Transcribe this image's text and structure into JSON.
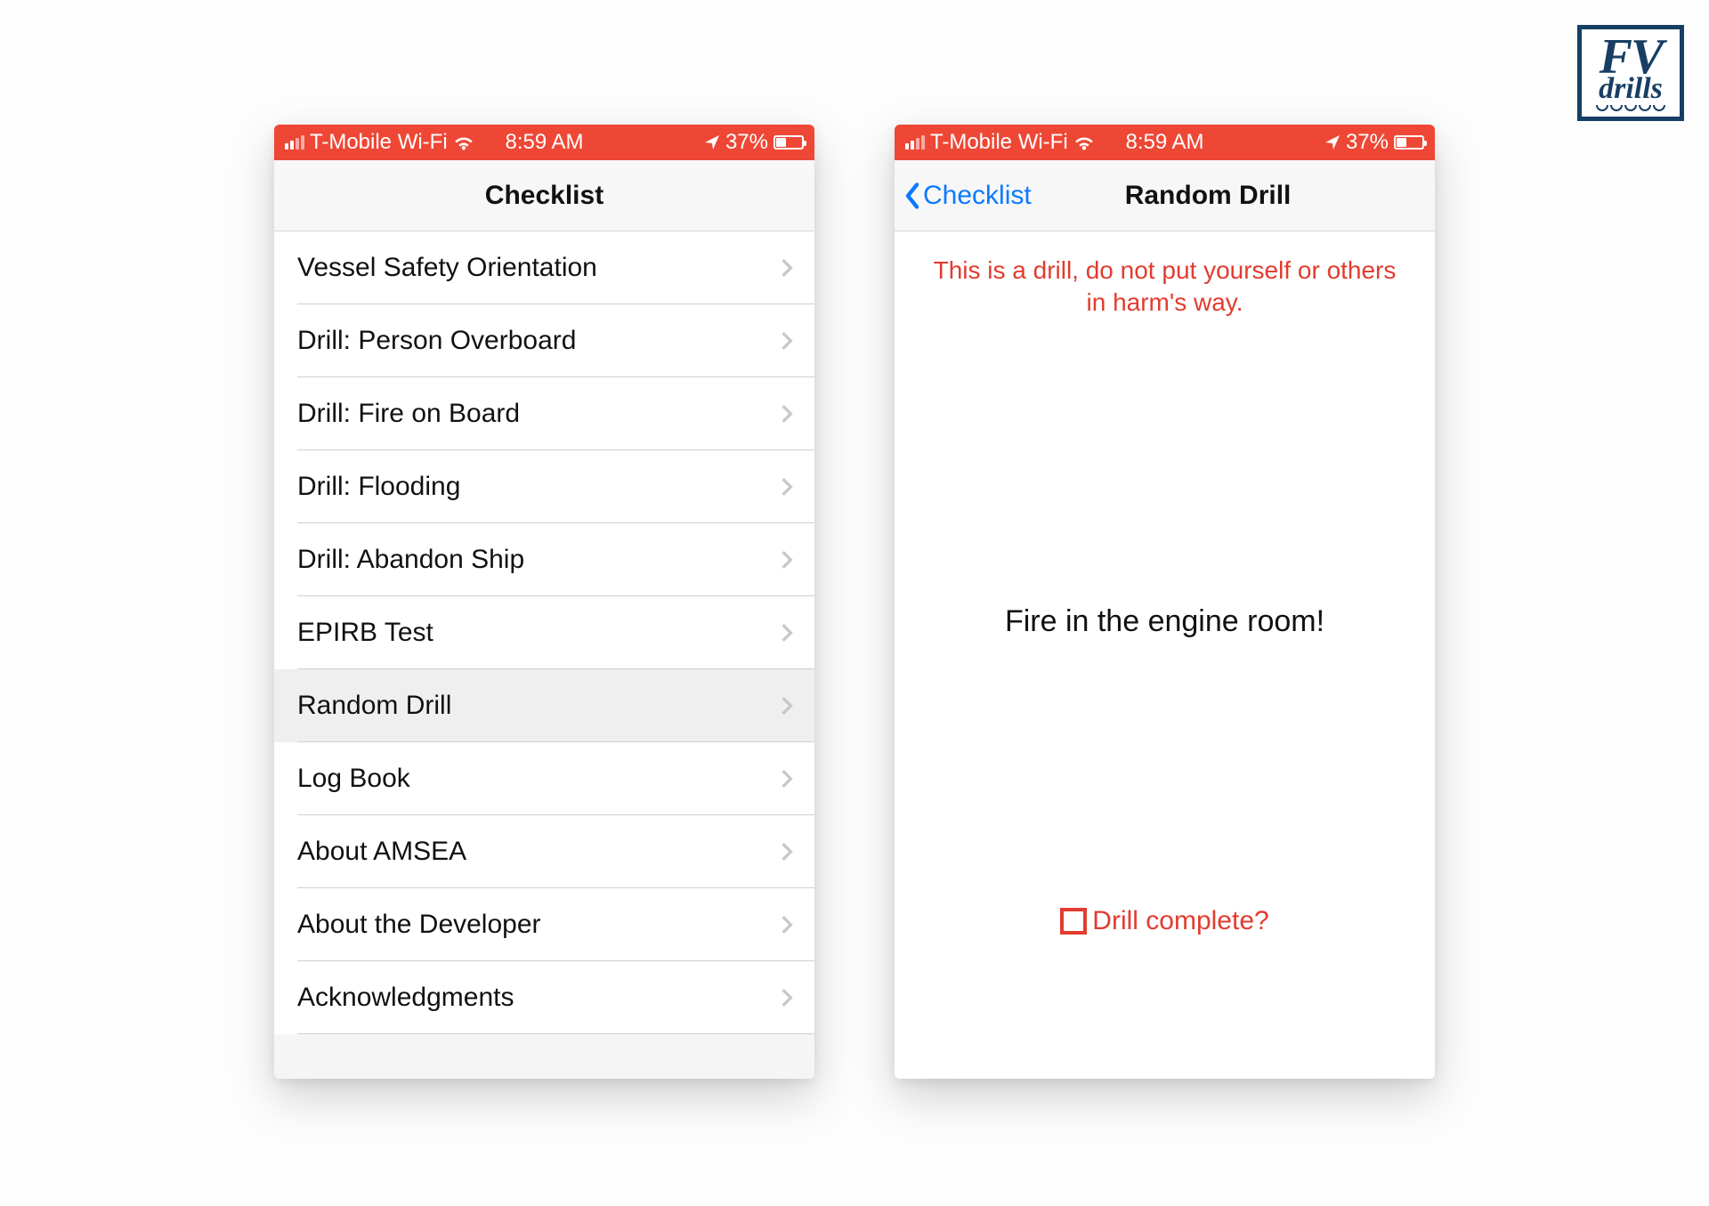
{
  "logo": {
    "line1": "FV",
    "line2": "drills"
  },
  "status": {
    "carrier": "T-Mobile Wi-Fi",
    "time": "8:59 AM",
    "battery_pct": "37%"
  },
  "colors": {
    "status_bar": "#ee4735",
    "link_blue": "#0b79ff",
    "warning_red": "#e13c2f",
    "logo_navy": "#183e63"
  },
  "screen_checklist": {
    "title": "Checklist",
    "items": [
      "Vessel Safety Orientation",
      "Drill: Person Overboard",
      "Drill: Fire on Board",
      "Drill: Flooding",
      "Drill: Abandon Ship",
      "EPIRB Test",
      "Random Drill",
      "Log Book",
      "About AMSEA",
      "About the Developer",
      "Acknowledgments"
    ],
    "selected_index": 6
  },
  "screen_drill": {
    "back_label": "Checklist",
    "title": "Random Drill",
    "warning": "This is a drill, do not put yourself or others in harm's way.",
    "scenario": "Fire in the engine room!",
    "complete_label": "Drill complete?"
  }
}
